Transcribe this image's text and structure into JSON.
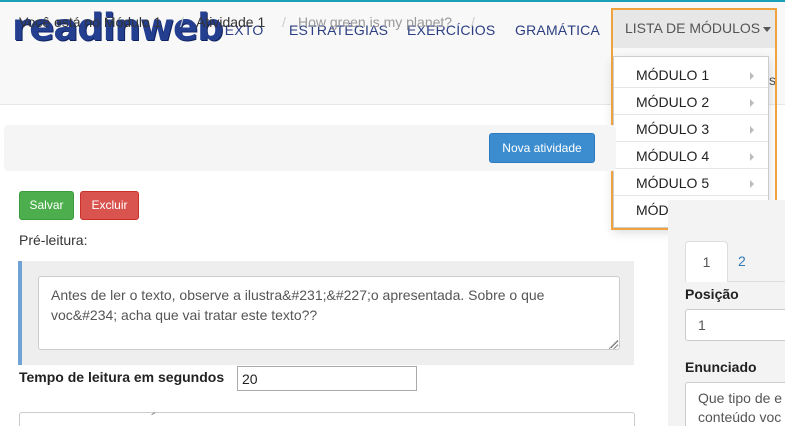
{
  "brand": {
    "logo": "readinweb"
  },
  "nav": {
    "items": [
      "TEXTO",
      "ESTRATÉGIAS",
      "EXERCÍCIOS",
      "GRAMÁTICA"
    ],
    "modules_menu": {
      "label": "LISTA DE MÓDULOS",
      "items": [
        "MÓDULO 1",
        "MÓDULO 2",
        "MÓDULO 3",
        "MÓDULO 4",
        "MÓDULO 5",
        "MÓDULO 6"
      ]
    },
    "partial_text": "s"
  },
  "breadcrumb": {
    "items": [
      "Você está no Módulo 1",
      "Atividade 1",
      "How green is my planet?"
    ],
    "separator": "/",
    "new_activity_label": "Nova atividade"
  },
  "actions": {
    "save_label": "Salvar",
    "delete_label": "Excluir"
  },
  "pre_reading": {
    "label": "Pré-leitura:",
    "text": "Antes de ler o texto, observe a ilustra&#231;&#227;o apresentada. Sobre o que voc&#234; acha que vai tratar este texto??"
  },
  "reading_time": {
    "label": "Tempo de leitura em segundos",
    "value": "20"
  },
  "side_panel": {
    "tabs": [
      "1",
      "2"
    ],
    "position_label": "Posição",
    "position_value": "1",
    "statement_label": "Enunciado",
    "statement_text": "Que tipo de e\nconteúdo voc"
  },
  "colors": {
    "accent_highlight": "#f0a23e",
    "primary_button": "#3c8dd0",
    "save_button": "#4cae4c",
    "delete_button": "#d9534f",
    "brand": "#243f8f"
  }
}
